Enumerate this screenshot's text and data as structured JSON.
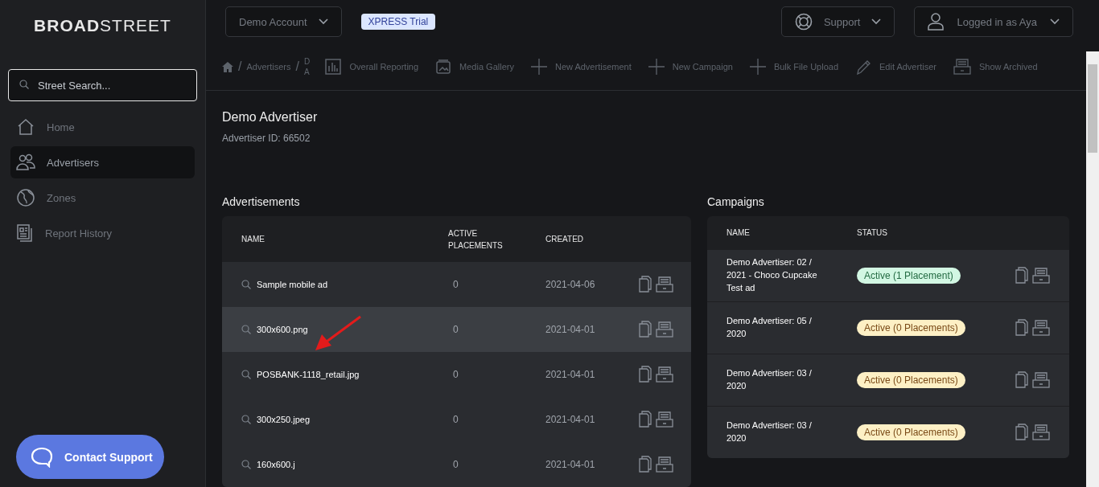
{
  "logo": {
    "bold": "BROAD",
    "light": "STREET"
  },
  "search": {
    "placeholder": "Street Search..."
  },
  "sidebar": {
    "items": [
      {
        "label": "Home",
        "selected": false
      },
      {
        "label": "Advertisers",
        "selected": true
      },
      {
        "label": "Zones",
        "selected": false
      },
      {
        "label": "Report History",
        "selected": false
      }
    ]
  },
  "contact_button": "Contact Support",
  "header": {
    "account": "Demo Account",
    "trial_badge": "XPRESS Trial",
    "support": "Support",
    "user": "Logged in as Aya"
  },
  "breadcrumb": [
    {
      "kind": "separator",
      "text": "/"
    },
    {
      "kind": "link",
      "text": "Advertisers"
    },
    {
      "kind": "separator",
      "text": "/"
    },
    {
      "kind": "stacked",
      "text": "DA"
    }
  ],
  "toolbar": [
    {
      "label": "Overall Reporting"
    },
    {
      "label": "Media Gallery"
    },
    {
      "label": "New Advertisement"
    },
    {
      "label": "New Campaign"
    },
    {
      "label": "Bulk File Upload"
    },
    {
      "label": "Edit Advertiser"
    },
    {
      "label": "Show Archived"
    }
  ],
  "advertiser": {
    "title": "Demo Advertiser",
    "id_line": "Advertiser ID: 66502"
  },
  "advertisements": {
    "heading": "Advertisements",
    "columns": [
      "NAME",
      "ACTIVE PLACEMENTS",
      "CREATED"
    ],
    "rows": [
      {
        "name": "Sample mobile ad",
        "placements": "0",
        "created": "2021-04-06",
        "selected": false
      },
      {
        "name": "300x600.png",
        "placements": "0",
        "created": "2021-04-01",
        "selected": true
      },
      {
        "name": "POSBANK-1118_retail.jpg",
        "placements": "0",
        "created": "2021-04-01",
        "selected": false
      },
      {
        "name": "300x250.jpeg",
        "placements": "0",
        "created": "2021-04-01",
        "selected": false
      },
      {
        "name": "160x600.j",
        "placements": "0",
        "created": "2021-04-01",
        "selected": false
      }
    ]
  },
  "campaigns": {
    "heading": "Campaigns",
    "columns": [
      "NAME",
      "STATUS"
    ],
    "rows": [
      {
        "name": "Demo Advertiser: 02 / 2021 - Choco Cupcake Test ad",
        "status": "Active (1 Placement)",
        "kind": "placed"
      },
      {
        "name": "Demo Advertiser: 05 / 2020",
        "status": "Active (0 Placements)",
        "kind": "empty"
      },
      {
        "name": "Demo Advertiser: 03 / 2020",
        "status": "Active (0 Placements)",
        "kind": "empty"
      },
      {
        "name": "Demo Advertiser: 03 / 2020",
        "status": "Active (0 Placements)",
        "kind": "empty"
      }
    ]
  }
}
